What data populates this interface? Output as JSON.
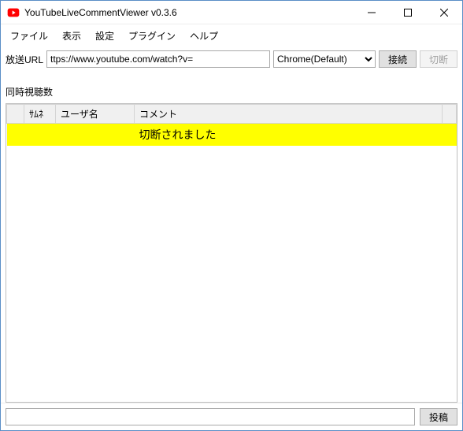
{
  "window": {
    "title": "YouTubeLiveCommentViewer v0.3.6"
  },
  "menu": {
    "file": "ファイル",
    "view": "表示",
    "settings": "設定",
    "plugin": "プラグイン",
    "help": "ヘルプ"
  },
  "urlbar": {
    "label": "放送URL",
    "url_value": "ttps://www.youtube.com/watch?v=",
    "browser_selected": "Chrome(Default)",
    "connect": "接続",
    "disconnect": "切断"
  },
  "status": {
    "viewers_label": "同時視聴数"
  },
  "table": {
    "headers": {
      "thumb": "ｻﾑﾈ",
      "user": "ユーザ名",
      "comment": "コメント"
    },
    "rows": [
      {
        "thumb": "",
        "user": "",
        "comment": "切断されました",
        "highlight": true
      }
    ]
  },
  "footer": {
    "input_value": "",
    "post": "投稿"
  }
}
